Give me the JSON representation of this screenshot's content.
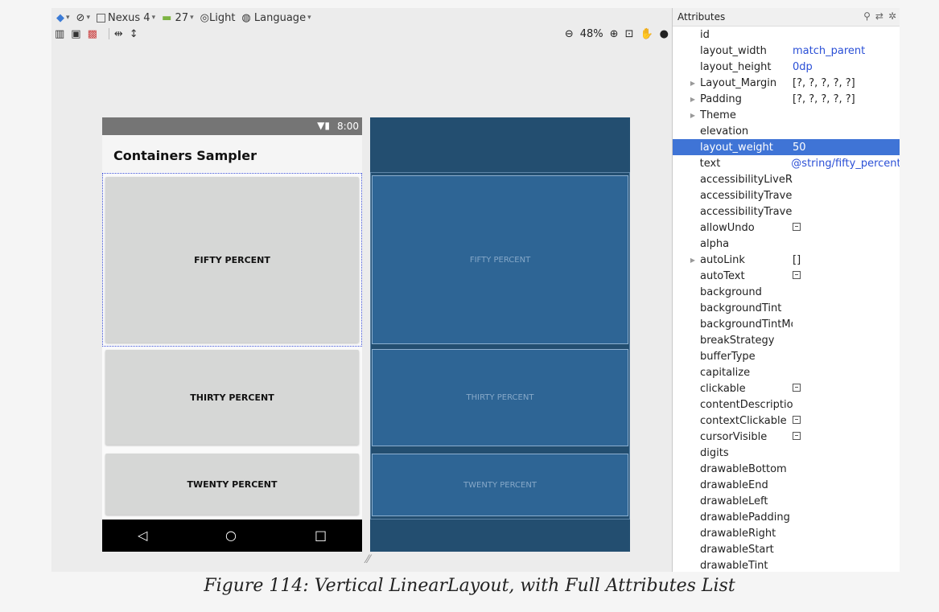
{
  "toolbar": {
    "row1": {
      "device": "Nexus 4",
      "api": "27",
      "theme": "Light",
      "language": "Language"
    },
    "zoom": "48%"
  },
  "phone": {
    "time": "8:00",
    "app_title": "Containers Sampler",
    "cells": [
      "FIFTY PERCENT",
      "THIRTY PERCENT",
      "TWENTY PERCENT"
    ],
    "nav": [
      "◁",
      "○",
      "□"
    ]
  },
  "blueprint": {
    "cells": [
      "FIFTY PERCENT",
      "THIRTY PERCENT",
      "TWENTY PERCENT"
    ]
  },
  "attributes": {
    "header": "Attributes",
    "rows": [
      {
        "name": "id",
        "value": ""
      },
      {
        "name": "layout_width",
        "value": "match_parent"
      },
      {
        "name": "layout_height",
        "value": "0dp"
      },
      {
        "name": "Layout_Margin",
        "value": "[?, ?, ?, ?, ?]",
        "expandable": true
      },
      {
        "name": "Padding",
        "value": "[?, ?, ?, ?, ?]",
        "expandable": true
      },
      {
        "name": "Theme",
        "value": "",
        "expandable": true
      },
      {
        "name": "elevation",
        "value": ""
      },
      {
        "name": "layout_weight",
        "value": "50",
        "selected": true
      },
      {
        "name": "text",
        "value": "@string/fifty_percent"
      },
      {
        "name": "accessibilityLiveR",
        "value": ""
      },
      {
        "name": "accessibilityTraver",
        "value": ""
      },
      {
        "name": "accessibilityTraver",
        "value": ""
      },
      {
        "name": "allowUndo",
        "value": "",
        "checkbox": true
      },
      {
        "name": "alpha",
        "value": ""
      },
      {
        "name": "autoLink",
        "value": "[]",
        "expandable": true
      },
      {
        "name": "autoText",
        "value": "",
        "checkbox": true
      },
      {
        "name": "background",
        "value": ""
      },
      {
        "name": "backgroundTint",
        "value": ""
      },
      {
        "name": "backgroundTintMo",
        "value": ""
      },
      {
        "name": "breakStrategy",
        "value": ""
      },
      {
        "name": "bufferType",
        "value": ""
      },
      {
        "name": "capitalize",
        "value": ""
      },
      {
        "name": "clickable",
        "value": "",
        "checkbox": true
      },
      {
        "name": "contentDescription",
        "value": ""
      },
      {
        "name": "contextClickable",
        "value": "",
        "checkbox": true
      },
      {
        "name": "cursorVisible",
        "value": "",
        "checkbox": true
      },
      {
        "name": "digits",
        "value": ""
      },
      {
        "name": "drawableBottom",
        "value": ""
      },
      {
        "name": "drawableEnd",
        "value": ""
      },
      {
        "name": "drawableLeft",
        "value": ""
      },
      {
        "name": "drawablePadding",
        "value": ""
      },
      {
        "name": "drawableRight",
        "value": ""
      },
      {
        "name": "drawableStart",
        "value": ""
      },
      {
        "name": "drawableTint",
        "value": ""
      }
    ]
  },
  "caption": "Figure 114: Vertical LinearLayout, with Full Attributes List"
}
